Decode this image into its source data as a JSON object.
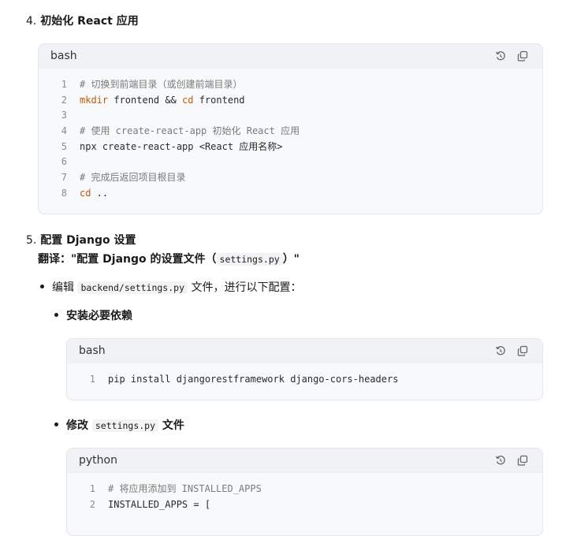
{
  "section4": {
    "number": "4.",
    "title": "初始化 React 应用",
    "code": {
      "lang": "bash",
      "lines": [
        {
          "n": "1",
          "segs": [
            {
              "t": "# 切换到前端目录（或创建前端目录）",
              "k": "comment"
            }
          ]
        },
        {
          "n": "2",
          "segs": [
            {
              "t": "mkdir",
              "k": "kw"
            },
            {
              "t": " frontend && ",
              "k": ""
            },
            {
              "t": "cd",
              "k": "kw"
            },
            {
              "t": " frontend",
              "k": ""
            }
          ]
        },
        {
          "n": "3",
          "segs": []
        },
        {
          "n": "4",
          "segs": [
            {
              "t": "# 使用 create-react-app 初始化 React 应用",
              "k": "comment"
            }
          ]
        },
        {
          "n": "5",
          "segs": [
            {
              "t": "npx create-react-app <React 应用名称>",
              "k": ""
            }
          ]
        },
        {
          "n": "6",
          "segs": []
        },
        {
          "n": "7",
          "segs": [
            {
              "t": "# 完成后返回项目根目录",
              "k": "comment"
            }
          ]
        },
        {
          "n": "8",
          "segs": [
            {
              "t": "cd",
              "k": "kw"
            },
            {
              "t": " ..",
              "k": ""
            }
          ]
        }
      ]
    }
  },
  "section5": {
    "number": "5.",
    "title": "配置 Django 设置",
    "translation_prefix": "翻译：\"配置 Django 的设置文件（",
    "translation_code": "settings.py",
    "translation_suffix": "）\"",
    "bullet1": {
      "prefix": "编辑",
      "code": "backend/settings.py",
      "suffix": "文件，进行以下配置："
    },
    "sub1": {
      "title": "安装必要依赖",
      "code": {
        "lang": "bash",
        "lines": [
          {
            "n": "1",
            "segs": [
              {
                "t": "pip install djangorestframework django-cors-headers",
                "k": ""
              }
            ]
          }
        ]
      }
    },
    "sub2": {
      "title_prefix": "修改",
      "title_code": "settings.py",
      "title_suffix": "文件",
      "code": {
        "lang": "python",
        "lines": [
          {
            "n": "1",
            "segs": [
              {
                "t": "# 将应用添加到 INSTALLED_APPS",
                "k": "comment"
              }
            ]
          },
          {
            "n": "2",
            "segs": [
              {
                "t": "INSTALLED_APPS = [",
                "k": ""
              }
            ]
          }
        ]
      }
    }
  },
  "icons": {
    "rerun": "rerun-icon",
    "copy": "copy-icon"
  }
}
